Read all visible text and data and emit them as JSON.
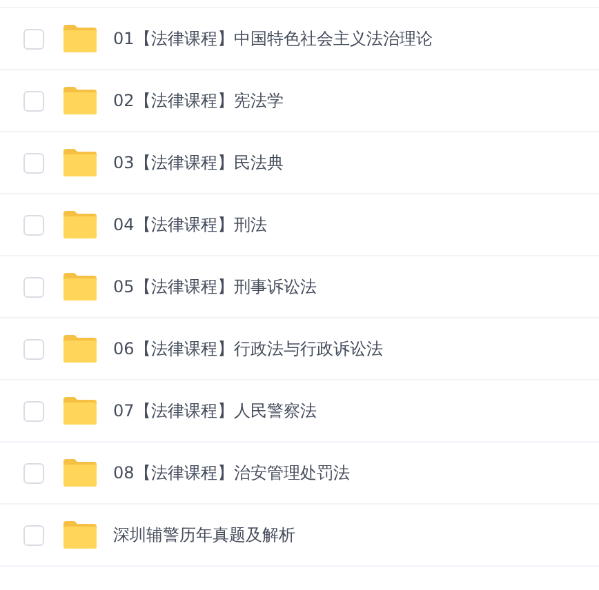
{
  "files": [
    {
      "name": "01【法律课程】中国特色社会主义法治理论",
      "checked": false
    },
    {
      "name": "02【法律课程】宪法学",
      "checked": false
    },
    {
      "name": "03【法律课程】民法典",
      "checked": false
    },
    {
      "name": "04【法律课程】刑法",
      "checked": false
    },
    {
      "name": "05【法律课程】刑事诉讼法",
      "checked": false
    },
    {
      "name": "06【法律课程】行政法与行政诉讼法",
      "checked": false
    },
    {
      "name": "07【法律课程】人民警察法",
      "checked": false
    },
    {
      "name": "08【法律课程】治安管理处罚法",
      "checked": false
    },
    {
      "name": "深圳辅警历年真题及解析",
      "checked": false
    }
  ]
}
